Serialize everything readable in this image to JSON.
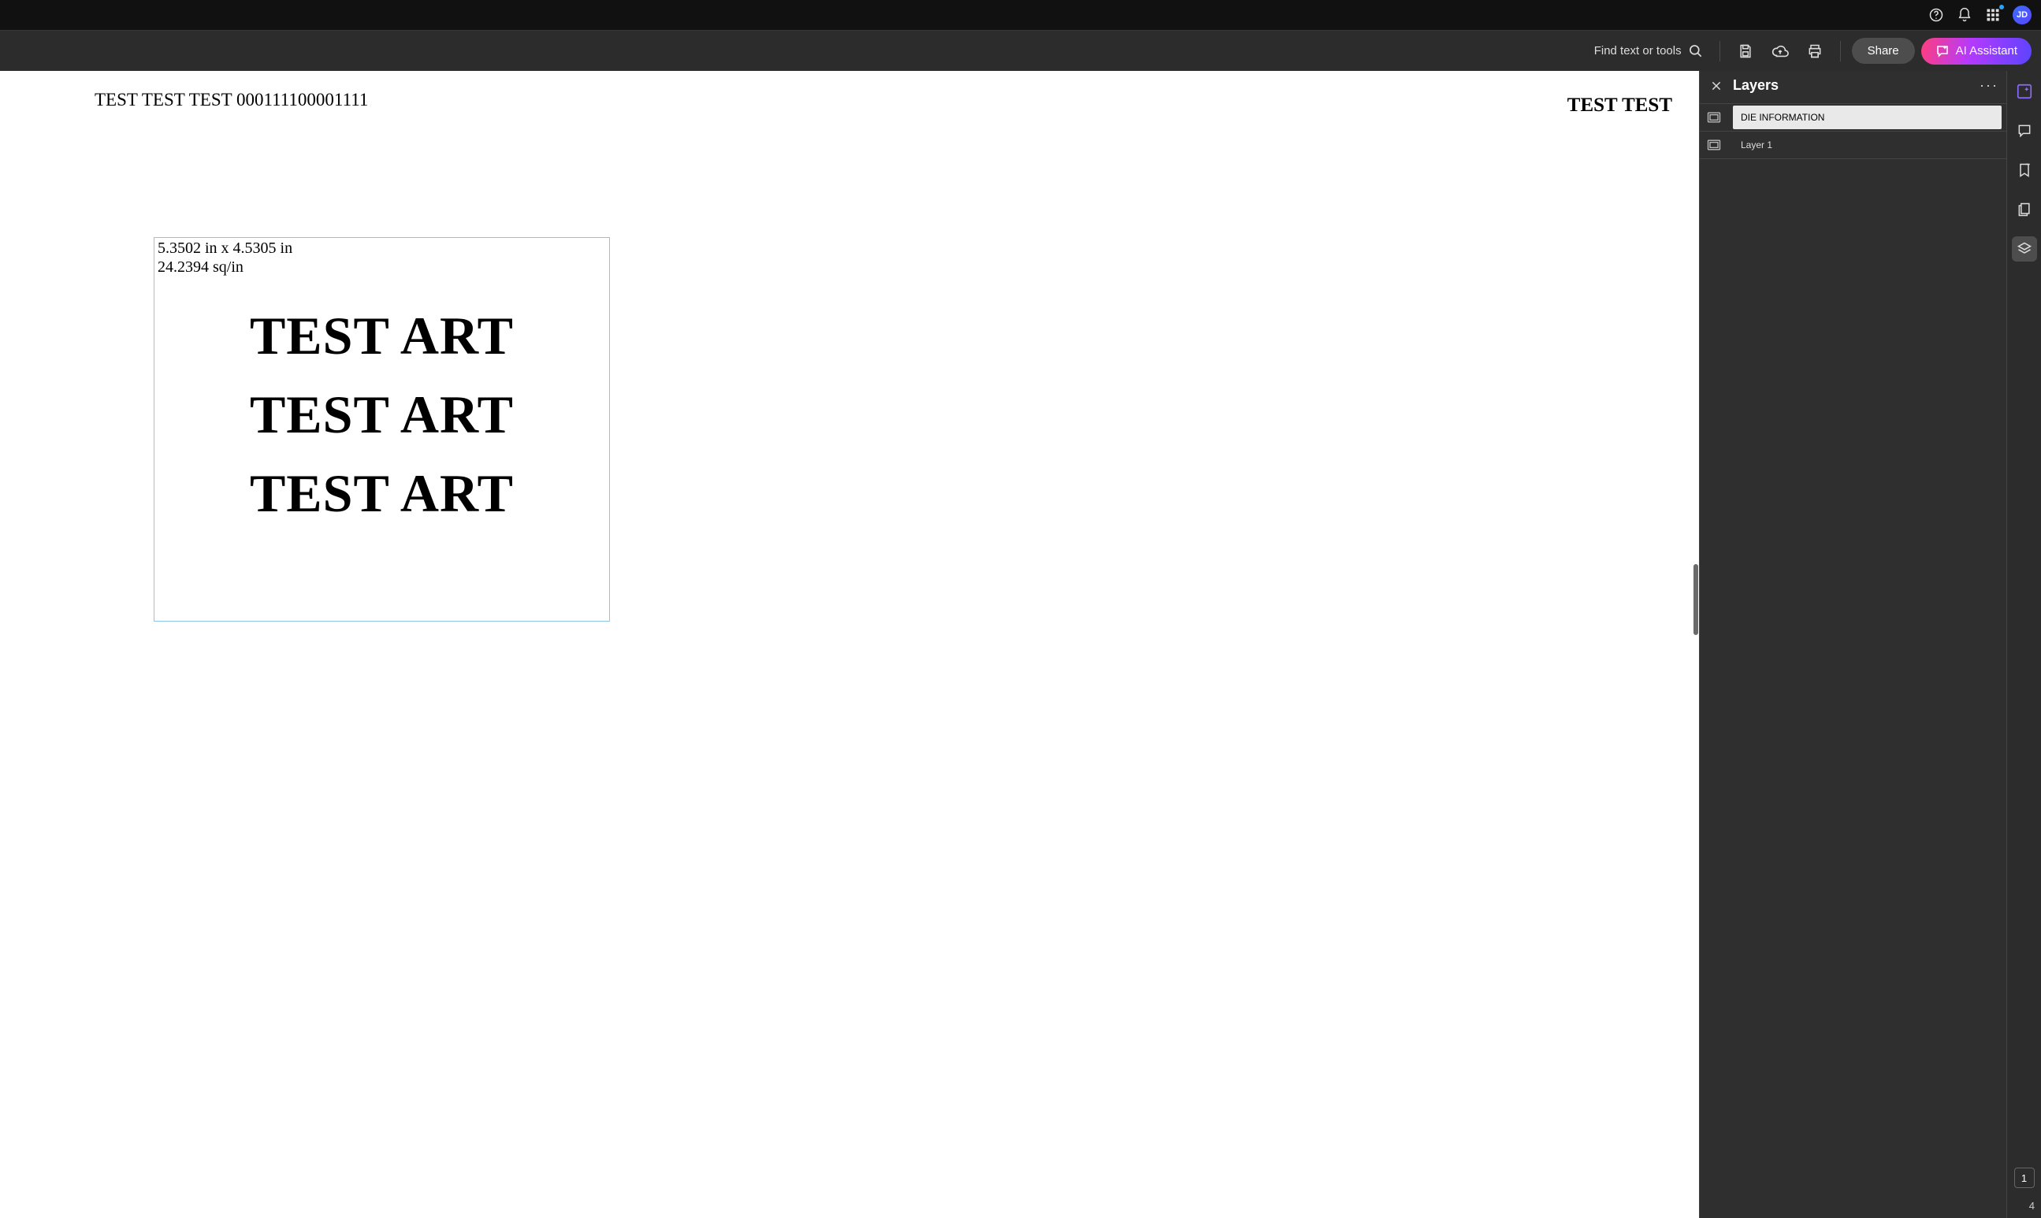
{
  "topbar": {
    "avatar_initials": "JD"
  },
  "toolbar": {
    "search_label": "Find text or tools",
    "share_label": "Share",
    "ai_label": "AI Assistant"
  },
  "document": {
    "header_left": "TEST TEST TEST 000111100001111",
    "header_right": "TEST TEST",
    "die_dim_line1": "5.3502 in x 4.5305 in",
    "die_dim_line2": "24.2394 sq/in",
    "art_line1": "TEST ART",
    "art_line2": "TEST ART",
    "art_line3": "TEST ART"
  },
  "layers_panel": {
    "title": "Layers",
    "items": [
      {
        "label": "DIE INFORMATION",
        "selected": true
      },
      {
        "label": "Layer 1",
        "selected": false
      }
    ]
  },
  "pagination": {
    "current": "1",
    "total": "4"
  }
}
